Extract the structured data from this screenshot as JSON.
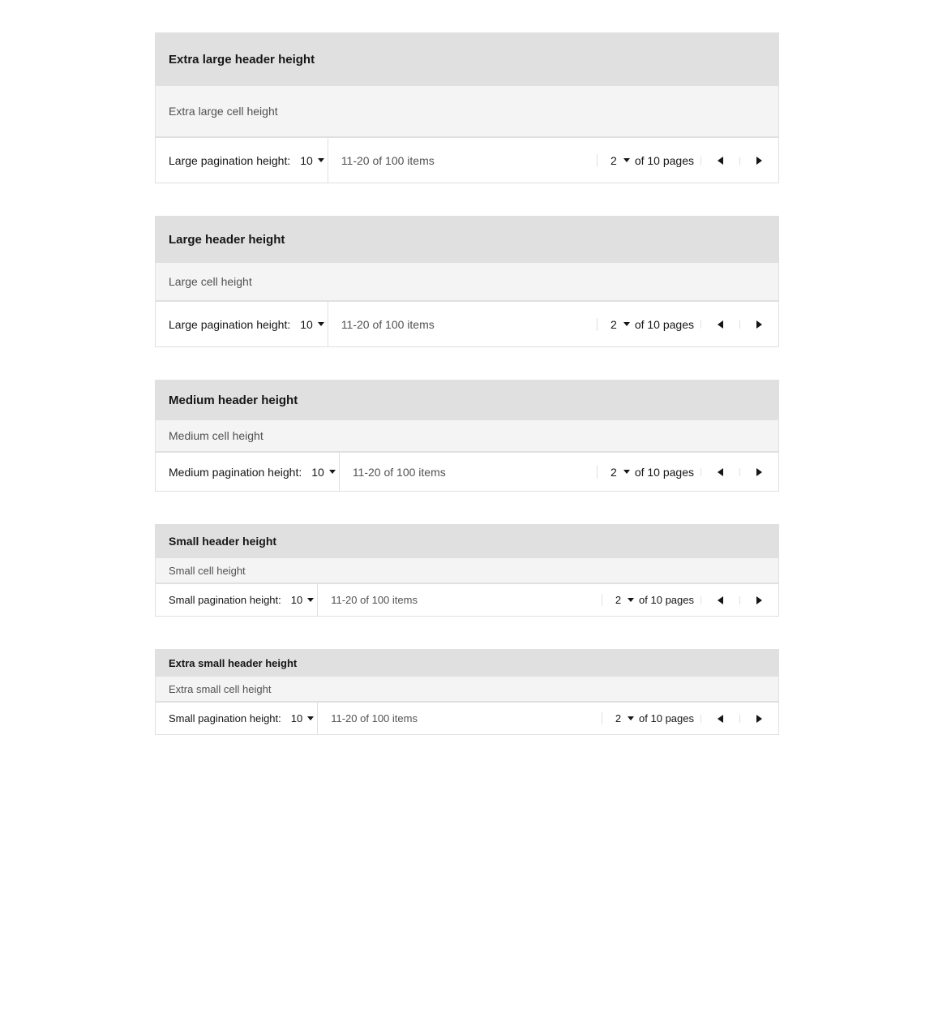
{
  "tables": [
    {
      "id": "extra-large",
      "headerSize": "xl",
      "headerLabel": "Extra large header height",
      "cellSize": "xl",
      "cellLabel": "Extra large cell height",
      "paginationSize": "xl",
      "paginationLabel": "Large pagination height:",
      "itemsPerPage": "10",
      "itemsText": "11-20 of 100 items",
      "currentPage": "2",
      "totalPages": "of 10 pages"
    },
    {
      "id": "large",
      "headerSize": "lg",
      "headerLabel": "Large header height",
      "cellSize": "lg",
      "cellLabel": "Large cell height",
      "paginationSize": "lg",
      "paginationLabel": "Large pagination height:",
      "itemsPerPage": "10",
      "itemsText": "11-20 of 100 items",
      "currentPage": "2",
      "totalPages": "of 10 pages"
    },
    {
      "id": "medium",
      "headerSize": "md",
      "headerLabel": "Medium header height",
      "cellSize": "md",
      "cellLabel": "Medium cell height",
      "paginationSize": "md",
      "paginationLabel": "Medium pagination height:",
      "itemsPerPage": "10",
      "itemsText": "11-20 of 100 items",
      "currentPage": "2",
      "totalPages": "of 10 pages"
    },
    {
      "id": "small",
      "headerSize": "sm",
      "headerLabel": "Small header height",
      "cellSize": "sm",
      "cellLabel": "Small cell height",
      "paginationSize": "sm",
      "paginationLabel": "Small pagination height:",
      "itemsPerPage": "10",
      "itemsText": "11-20 of 100 items",
      "currentPage": "2",
      "totalPages": "of 10 pages"
    },
    {
      "id": "extra-small",
      "headerSize": "xs",
      "headerLabel": "Extra small header height",
      "cellSize": "xs",
      "cellLabel": "Extra small cell height",
      "paginationSize": "xs",
      "paginationLabel": "Small pagination height:",
      "itemsPerPage": "10",
      "itemsText": "11-20 of 100 items",
      "currentPage": "2",
      "totalPages": "of 10 pages"
    }
  ]
}
